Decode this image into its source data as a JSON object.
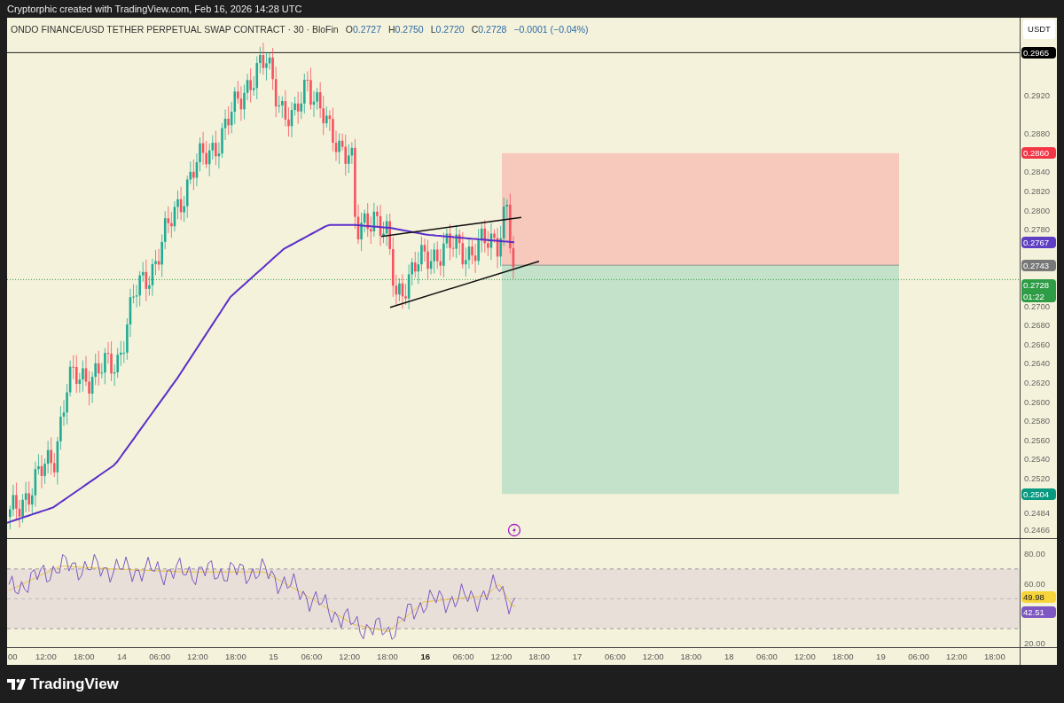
{
  "header": {
    "credit": "Cryptorphic created with TradingView.com, Feb 16, 2026 14:28 UTC"
  },
  "chart": {
    "title": "ONDO FINANCE/USD TETHER PERPETUAL SWAP CONTRACT · 30 · BloFin",
    "ohlc": [
      {
        "label": "O",
        "value": "0.2727"
      },
      {
        "label": "H",
        "value": "0.2750"
      },
      {
        "label": "L",
        "value": "0.2720"
      },
      {
        "label": "C",
        "value": "0.2728"
      }
    ],
    "change": "−0.0001 (−0.04%)"
  },
  "price_axis": {
    "currency": "USDT",
    "ticks": [
      "0.2920",
      "0.2880",
      "0.2840",
      "0.2820",
      "0.2800",
      "0.2780",
      "0.2700",
      "0.2680",
      "0.2660",
      "0.2640",
      "0.2620",
      "0.2600",
      "0.2580",
      "0.2560",
      "0.2540",
      "0.2520",
      "0.2484",
      "0.2466"
    ],
    "markers": [
      {
        "value": "0.2965",
        "color": "#000000"
      },
      {
        "value": "0.2860",
        "color": "#f23645"
      },
      {
        "value": "0.2767",
        "color": "#5e3fc4"
      },
      {
        "value": "0.2743",
        "color": "#787878"
      },
      {
        "value": "0.2728",
        "countdown": "01:22",
        "color": "#2e9d45"
      },
      {
        "value": "0.2504",
        "color": "#089981"
      }
    ]
  },
  "rsi_axis": {
    "ticks": [
      "80.00",
      "60.00",
      "20.00"
    ],
    "markers": [
      {
        "value": "49.98",
        "color": "#f7d43b"
      },
      {
        "value": "42.51",
        "color": "#7e57c2"
      }
    ]
  },
  "time_axis": {
    "labels": [
      {
        "text": "00",
        "major": false
      },
      {
        "text": "12:00",
        "major": false
      },
      {
        "text": "18:00",
        "major": false
      },
      {
        "text": "14",
        "major": false
      },
      {
        "text": "06:00",
        "major": false
      },
      {
        "text": "12:00",
        "major": false
      },
      {
        "text": "18:00",
        "major": false
      },
      {
        "text": "15",
        "major": false
      },
      {
        "text": "06:00",
        "major": false
      },
      {
        "text": "12:00",
        "major": false
      },
      {
        "text": "18:00",
        "major": false
      },
      {
        "text": "16",
        "major": true
      },
      {
        "text": "06:00",
        "major": false
      },
      {
        "text": "12:00",
        "major": false
      },
      {
        "text": "18:00",
        "major": false
      },
      {
        "text": "17",
        "major": false
      },
      {
        "text": "06:00",
        "major": false
      },
      {
        "text": "12:00",
        "major": false
      },
      {
        "text": "18:00",
        "major": false
      },
      {
        "text": "18",
        "major": false
      },
      {
        "text": "06:00",
        "major": false
      },
      {
        "text": "12:00",
        "major": false
      },
      {
        "text": "18:00",
        "major": false
      },
      {
        "text": "19",
        "major": false
      },
      {
        "text": "06:00",
        "major": false
      },
      {
        "text": "12:00",
        "major": false
      },
      {
        "text": "18:00",
        "major": false
      }
    ]
  },
  "footer": {
    "logo": "TradingView"
  }
}
